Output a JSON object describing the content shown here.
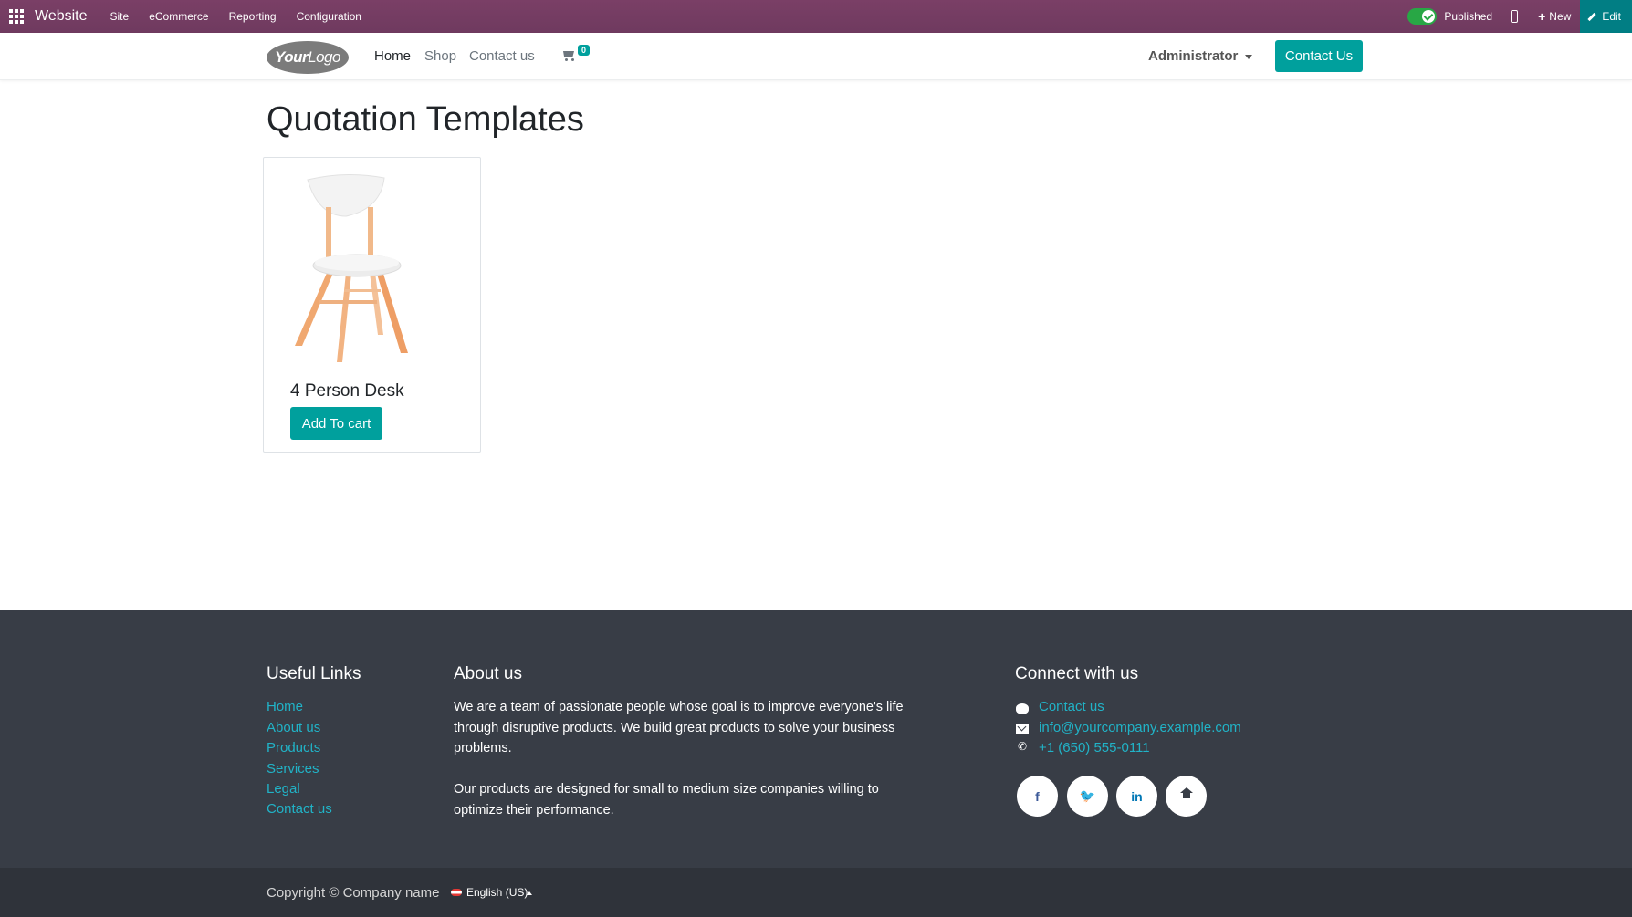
{
  "adminbar": {
    "brand": "Website",
    "menus": [
      "Site",
      "eCommerce",
      "Reporting",
      "Configuration"
    ],
    "published_label": "Published",
    "published_on": true,
    "new_label": "New",
    "edit_label": "Edit",
    "color": "#7a3f66"
  },
  "header": {
    "logo_text_bold": "Your",
    "logo_text_thin": "Logo",
    "nav": [
      "Home",
      "Shop",
      "Contact us"
    ],
    "cart_count": "0",
    "user_menu": "Administrator",
    "cta": "Contact Us",
    "accent": "#00a09d"
  },
  "main": {
    "title": "Quotation Templates",
    "products": [
      {
        "name": "4 Person Desk",
        "button": "Add To cart",
        "image": "chair-icon"
      }
    ]
  },
  "footer": {
    "useful_links_title": "Useful Links",
    "useful_links": [
      "Home",
      "About us",
      "Products",
      "Services",
      "Legal",
      "Contact us"
    ],
    "about_title": "About us",
    "about_p1": "We are a team of passionate people whose goal is to improve everyone's life through disruptive products. We build great products to solve your business problems.",
    "about_p2": "Our products are designed for small to medium size companies willing to optimize their performance.",
    "connect_title": "Connect with us",
    "contact_link": "Contact us",
    "email": "info@yourcompany.example.com",
    "phone": "+1 (650) 555-0111",
    "social": [
      "f",
      "t",
      "in",
      "home"
    ],
    "link_color": "#21b3c7"
  },
  "bottom": {
    "copyright": "Copyright © Company name",
    "language": "English (US)"
  }
}
